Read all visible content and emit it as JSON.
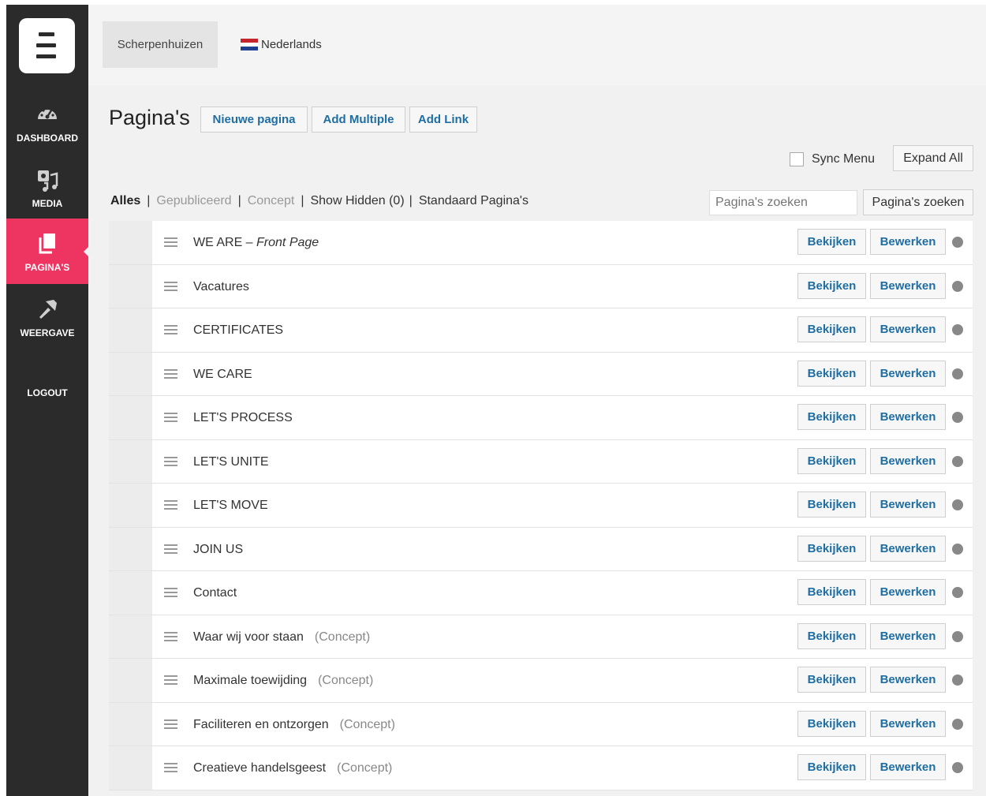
{
  "sidebar": {
    "items": [
      {
        "label": "DASHBOARD",
        "icon": "dashboard-gauge-icon"
      },
      {
        "label": "MEDIA",
        "icon": "media-icon"
      },
      {
        "label": "PAGINA'S",
        "icon": "pages-icon",
        "active": true
      },
      {
        "label": "WEERGAVE",
        "icon": "appearance-brush-icon"
      }
    ],
    "logout_label": "LOGOUT",
    "active_color": "#ee3562"
  },
  "topbar": {
    "site_name": "Scherpenhuizen",
    "language": "Nederlands"
  },
  "header": {
    "title": "Pagina's",
    "new_page": "Nieuwe pagina",
    "add_multiple": "Add Multiple",
    "add_link": "Add Link"
  },
  "toolbar": {
    "sync_menu": "Sync Menu",
    "expand_all": "Expand All",
    "search_placeholder": "Pagina's zoeken",
    "search_button": "Pagina's zoeken"
  },
  "filters": {
    "all": "Alles",
    "published": "Gepubliceerd",
    "concept": "Concept",
    "show_hidden": "Show Hidden (0)",
    "default_pages": "Standaard Pagina's"
  },
  "row_actions": {
    "view": "Bekijken",
    "edit": "Bewerken"
  },
  "pages": [
    {
      "title": "WE ARE – ",
      "subtitle": "Front Page",
      "status": ""
    },
    {
      "title": "Vacatures",
      "subtitle": "",
      "status": ""
    },
    {
      "title": "CERTIFICATES",
      "subtitle": "",
      "status": ""
    },
    {
      "title": "WE CARE",
      "subtitle": "",
      "status": ""
    },
    {
      "title": "LET'S PROCESS",
      "subtitle": "",
      "status": ""
    },
    {
      "title": "LET'S UNITE",
      "subtitle": "",
      "status": ""
    },
    {
      "title": "LET'S MOVE",
      "subtitle": "",
      "status": ""
    },
    {
      "title": "JOIN US",
      "subtitle": "",
      "status": ""
    },
    {
      "title": "Contact",
      "subtitle": "",
      "status": ""
    },
    {
      "title": "Waar wij voor staan",
      "subtitle": "",
      "status": "(Concept)"
    },
    {
      "title": "Maximale toewijding",
      "subtitle": "",
      "status": "(Concept)"
    },
    {
      "title": "Faciliteren en ontzorgen",
      "subtitle": "",
      "status": "(Concept)"
    },
    {
      "title": "Creatieve handelsgeest",
      "subtitle": "",
      "status": "(Concept)"
    }
  ]
}
